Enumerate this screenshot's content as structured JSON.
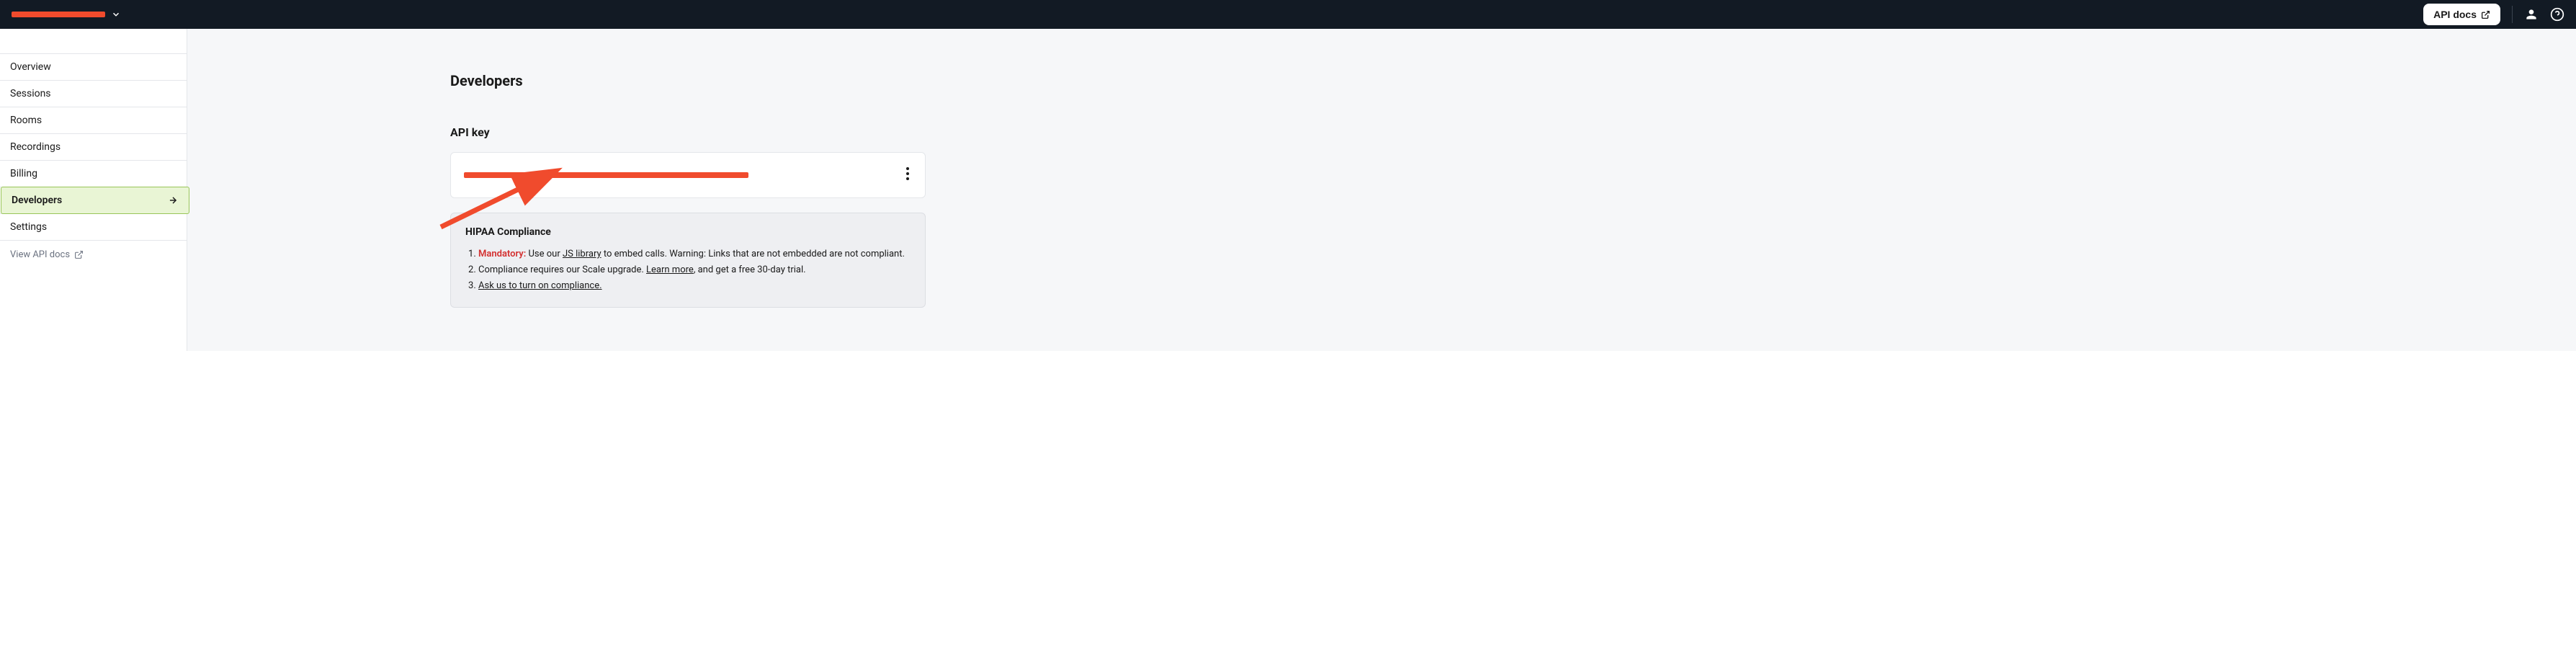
{
  "header": {
    "api_docs_label": "API docs"
  },
  "sidebar": {
    "items": [
      "Overview",
      "Sessions",
      "Rooms",
      "Recordings",
      "Billing",
      "Developers",
      "Settings"
    ],
    "active_index": 5,
    "view_api_docs": "View API docs"
  },
  "main": {
    "title": "Developers",
    "api_key_section_title": "API key",
    "compliance": {
      "title": "HIPAA Compliance",
      "mandatory_label": "Mandatory:",
      "item1_text1": " Use our ",
      "item1_link": "JS library",
      "item1_text2": " to embed calls. Warning: Links that are not embedded are not compliant.",
      "item2_text1": "Compliance requires our Scale upgrade. ",
      "item2_link": "Learn more",
      "item2_text2": ", and get a free 30-day trial.",
      "item3_link": "Ask us to turn on compliance."
    }
  },
  "colors": {
    "redaction": "#f04b2d",
    "topbar_bg": "#121a24",
    "sidebar_active_bg": "#e9f5d5",
    "sidebar_active_border": "#99c659",
    "mandatory_text": "#d32f2f"
  }
}
